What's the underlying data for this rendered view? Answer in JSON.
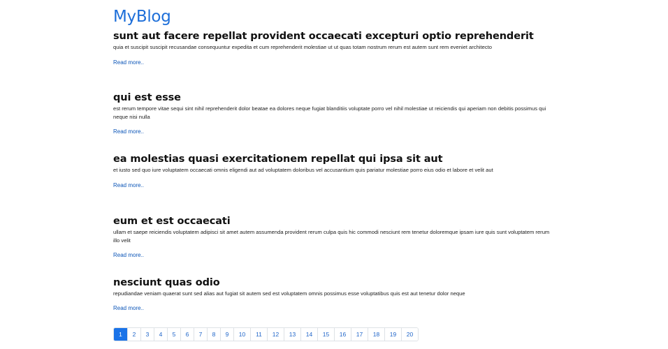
{
  "header": {
    "brand": "MyBlog"
  },
  "posts": [
    {
      "title": "sunt aut facere repellat provident occaecati excepturi optio reprehenderit",
      "body": "quia et suscipit suscipit recusandae consequuntur expedita et cum reprehenderit molestiae ut ut quas totam nostrum rerum est autem sunt rem eveniet architecto",
      "read_more": "Read more.."
    },
    {
      "title": "qui est esse",
      "body": "est rerum tempore vitae sequi sint nihil reprehenderit dolor beatae ea dolores neque fugiat blanditiis voluptate porro vel nihil molestiae ut reiciendis qui aperiam non debitis possimus qui neque nisi nulla",
      "read_more": "Read more.."
    },
    {
      "title": "ea molestias quasi exercitationem repellat qui ipsa sit aut",
      "body": "et iusto sed quo iure voluptatem occaecati omnis eligendi aut ad voluptatem doloribus vel accusantium quis pariatur molestiae porro eius odio et labore et velit aut",
      "read_more": "Read more.."
    },
    {
      "title": "eum et est occaecati",
      "body": "ullam et saepe reiciendis voluptatem adipisci sit amet autem assumenda provident rerum culpa quis hic commodi nesciunt rem tenetur doloremque ipsam iure quis sunt voluptatem rerum illo velit",
      "read_more": "Read more.."
    },
    {
      "title": "nesciunt quas odio",
      "body": "repudiandae veniam quaerat sunt sed alias aut fugiat sit autem sed est voluptatem omnis possimus esse voluptatibus quis est aut tenetur dolor neque",
      "read_more": "Read more.."
    }
  ],
  "pagination": {
    "active": "1",
    "pages": [
      "1",
      "2",
      "3",
      "4",
      "5",
      "6",
      "7",
      "8",
      "9",
      "10",
      "11",
      "12",
      "13",
      "14",
      "15",
      "16",
      "17",
      "18",
      "19",
      "20"
    ]
  },
  "colors": {
    "brand": "#1e6fd9",
    "link": "#0d56b8",
    "active_page_bg": "#1a73e8"
  }
}
